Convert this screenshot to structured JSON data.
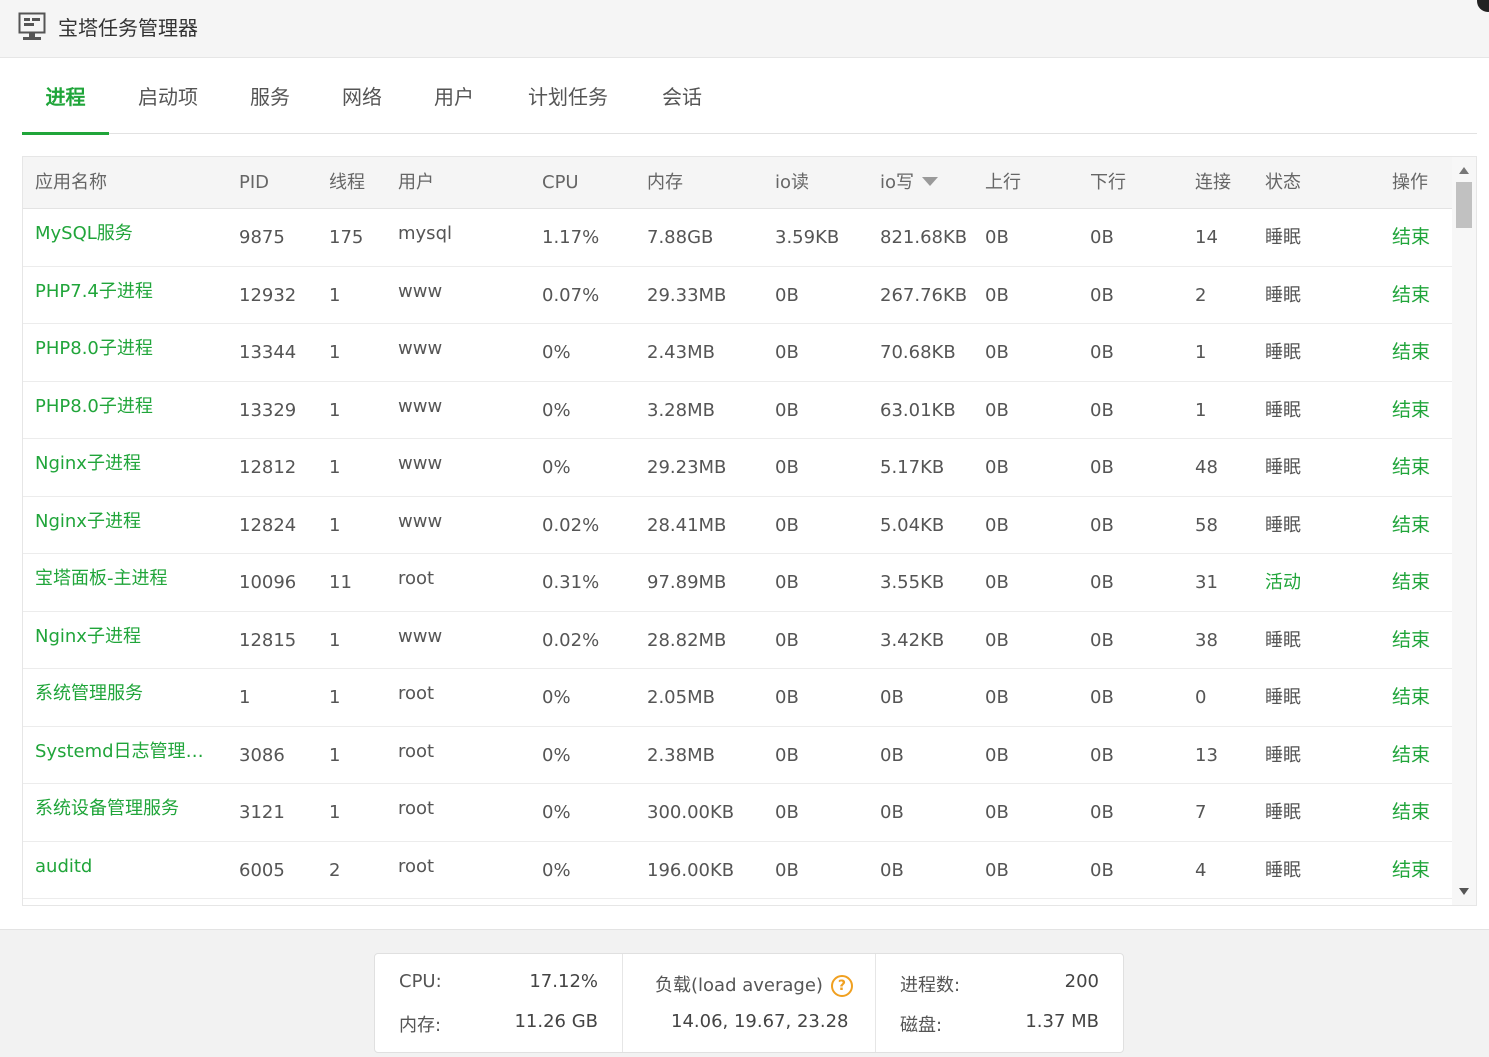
{
  "window": {
    "title": "宝塔任务管理器"
  },
  "tabs": [
    {
      "label": "进程",
      "active": true
    },
    {
      "label": "启动项"
    },
    {
      "label": "服务"
    },
    {
      "label": "网络"
    },
    {
      "label": "用户"
    },
    {
      "label": "计划任务"
    },
    {
      "label": "会话"
    }
  ],
  "table": {
    "headers": {
      "name": "应用名称",
      "pid": "PID",
      "threads": "线程",
      "user": "用户",
      "cpu": "CPU",
      "memory": "内存",
      "io_read": "io读",
      "io_write": "io写",
      "upload": "上行",
      "download": "下行",
      "connections": "连接",
      "status": "状态",
      "action": "操作"
    },
    "sorted_column": "io_write",
    "rows": [
      {
        "name": "MySQL服务",
        "pid": "9875",
        "threads": "175",
        "user": "mysql",
        "cpu": "1.17%",
        "memory": "7.88GB",
        "io_read": "3.59KB",
        "io_write": "821.68KB",
        "upload": "0B",
        "download": "0B",
        "connections": "14",
        "status": "睡眠",
        "action": "结束"
      },
      {
        "name": "PHP7.4子进程",
        "pid": "12932",
        "threads": "1",
        "user": "www",
        "cpu": "0.07%",
        "memory": "29.33MB",
        "io_read": "0B",
        "io_write": "267.76KB",
        "upload": "0B",
        "download": "0B",
        "connections": "2",
        "status": "睡眠",
        "action": "结束"
      },
      {
        "name": "PHP8.0子进程",
        "pid": "13344",
        "threads": "1",
        "user": "www",
        "cpu": "0%",
        "memory": "2.43MB",
        "io_read": "0B",
        "io_write": "70.68KB",
        "upload": "0B",
        "download": "0B",
        "connections": "1",
        "status": "睡眠",
        "action": "结束"
      },
      {
        "name": "PHP8.0子进程",
        "pid": "13329",
        "threads": "1",
        "user": "www",
        "cpu": "0%",
        "memory": "3.28MB",
        "io_read": "0B",
        "io_write": "63.01KB",
        "upload": "0B",
        "download": "0B",
        "connections": "1",
        "status": "睡眠",
        "action": "结束"
      },
      {
        "name": "Nginx子进程",
        "pid": "12812",
        "threads": "1",
        "user": "www",
        "cpu": "0%",
        "memory": "29.23MB",
        "io_read": "0B",
        "io_write": "5.17KB",
        "upload": "0B",
        "download": "0B",
        "connections": "48",
        "status": "睡眠",
        "action": "结束"
      },
      {
        "name": "Nginx子进程",
        "pid": "12824",
        "threads": "1",
        "user": "www",
        "cpu": "0.02%",
        "memory": "28.41MB",
        "io_read": "0B",
        "io_write": "5.04KB",
        "upload": "0B",
        "download": "0B",
        "connections": "58",
        "status": "睡眠",
        "action": "结束"
      },
      {
        "name": "宝塔面板-主进程",
        "pid": "10096",
        "threads": "11",
        "user": "root",
        "cpu": "0.31%",
        "memory": "97.89MB",
        "io_read": "0B",
        "io_write": "3.55KB",
        "upload": "0B",
        "download": "0B",
        "connections": "31",
        "status": "活动",
        "action": "结束"
      },
      {
        "name": "Nginx子进程",
        "pid": "12815",
        "threads": "1",
        "user": "www",
        "cpu": "0.02%",
        "memory": "28.82MB",
        "io_read": "0B",
        "io_write": "3.42KB",
        "upload": "0B",
        "download": "0B",
        "connections": "38",
        "status": "睡眠",
        "action": "结束"
      },
      {
        "name": "系统管理服务",
        "pid": "1",
        "threads": "1",
        "user": "root",
        "cpu": "0%",
        "memory": "2.05MB",
        "io_read": "0B",
        "io_write": "0B",
        "upload": "0B",
        "download": "0B",
        "connections": "0",
        "status": "睡眠",
        "action": "结束"
      },
      {
        "name": "Systemd日志管理服...",
        "pid": "3086",
        "threads": "1",
        "user": "root",
        "cpu": "0%",
        "memory": "2.38MB",
        "io_read": "0B",
        "io_write": "0B",
        "upload": "0B",
        "download": "0B",
        "connections": "13",
        "status": "睡眠",
        "action": "结束"
      },
      {
        "name": "系统设备管理服务",
        "pid": "3121",
        "threads": "1",
        "user": "root",
        "cpu": "0%",
        "memory": "300.00KB",
        "io_read": "0B",
        "io_write": "0B",
        "upload": "0B",
        "download": "0B",
        "connections": "7",
        "status": "睡眠",
        "action": "结束"
      },
      {
        "name": "auditd",
        "pid": "6005",
        "threads": "2",
        "user": "root",
        "cpu": "0%",
        "memory": "196.00KB",
        "io_read": "0B",
        "io_write": "0B",
        "upload": "0B",
        "download": "0B",
        "connections": "4",
        "status": "睡眠",
        "action": "结束"
      }
    ]
  },
  "summary": {
    "cpu_label": "CPU:",
    "cpu_value": "17.12%",
    "mem_label": "内存:",
    "mem_value": "11.26 GB",
    "load_label": "负载(load average)",
    "load_help": "?",
    "load_value": "14.06, 19.67, 23.28",
    "proc_label": "进程数:",
    "proc_value": "200",
    "disk_label": "磁盘:",
    "disk_value": "1.37 MB"
  },
  "colors": {
    "accent": "#20a53a",
    "help": "#f0a020"
  }
}
